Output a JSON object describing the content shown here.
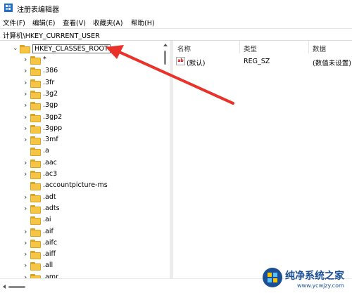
{
  "window": {
    "title": "注册表编辑器"
  },
  "menu": [
    "文件(F)",
    "编辑(E)",
    "查看(V)",
    "收藏夹(A)",
    "帮助(H)"
  ],
  "address": "计算机\\HKEY_CURRENT_USER",
  "tree": {
    "root": "HKEY_CLASSES_ROOT",
    "children": [
      "*",
      ".386",
      ".3fr",
      ".3g2",
      ".3gp",
      ".3gp2",
      ".3gpp",
      ".3mf",
      ".a",
      ".aac",
      ".ac3",
      ".accountpicture-ms",
      ".adt",
      ".adts",
      ".ai",
      ".aif",
      ".aifc",
      ".aiff",
      ".all",
      ".amr"
    ],
    "no_expander": [
      ".a",
      ".accountpicture-ms",
      ".ai"
    ]
  },
  "values_pane": {
    "columns": [
      "名称",
      "类型",
      "数据"
    ],
    "rows": [
      {
        "name": "(默认)",
        "type": "REG_SZ",
        "data": "(数值未设置)",
        "icon": "string-value-icon"
      }
    ]
  },
  "annotation": {
    "arrow_color": "#e8322a"
  },
  "watermark": {
    "brand": "纯净系统之家",
    "url": "www.ycwjzy.com"
  },
  "colors": {
    "folder": "#f6c545",
    "folder_edge": "#d9a420"
  }
}
